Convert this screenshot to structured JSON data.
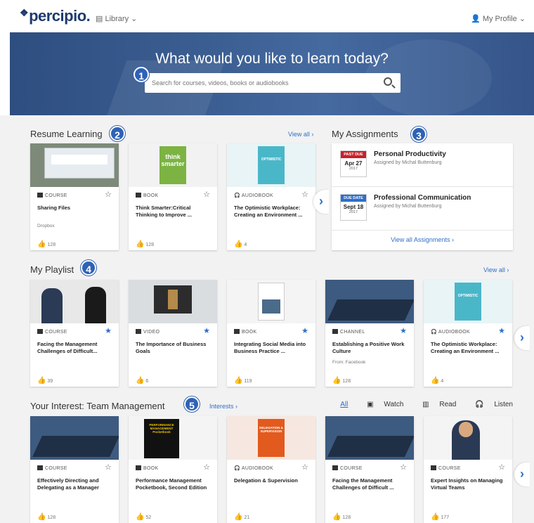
{
  "header": {
    "logo": "percipio.",
    "library": "Library",
    "profile": "My Profile"
  },
  "hero": {
    "title": "What would you like to learn today?",
    "search_placeholder": "Search for courses, videos, books or audiobooks"
  },
  "badges": [
    "1",
    "2",
    "3",
    "4",
    "5"
  ],
  "resume": {
    "title": "Resume Learning",
    "view_all": "View all ›",
    "cards": [
      {
        "type": "COURSE",
        "title": "Sharing Files",
        "sub": "Dropbox",
        "likes": "128",
        "liked": false,
        "starred": false
      },
      {
        "type": "BOOK",
        "title": "Think Smarter:Critical Thinking to Improve ...",
        "sub": "",
        "likes": "128",
        "liked": true,
        "starred": false
      },
      {
        "type": "AUDIOBOOK",
        "title": "The Optimistic Workplace: Creating an Environment ...",
        "sub": "",
        "likes": "4",
        "liked": false,
        "starred": false
      }
    ]
  },
  "assignments": {
    "title": "My Assignments",
    "items": [
      {
        "tag": "PAST DUE",
        "date": "Apr 27",
        "year": "2017",
        "title": "Personal Productivity",
        "by": "Assigned by Michal Buttenburg",
        "color": "#c8202a"
      },
      {
        "tag": "DUE DATE",
        "date": "Sept 18",
        "year": "2017",
        "title": "Professional Communication",
        "by": "Assigned by Michal Buttenburg",
        "color": "#2f6fc9"
      }
    ],
    "view_all": "View all Assignments ›"
  },
  "playlist": {
    "title": "My Playlist",
    "view_all": "View all ›",
    "cards": [
      {
        "type": "COURSE",
        "title": "Facing the Management Challenges of Difficult...",
        "sub": "",
        "likes": "39",
        "liked": false
      },
      {
        "type": "VIDEO",
        "title": "The Importance of Business Goals",
        "sub": "",
        "likes": "6",
        "liked": false
      },
      {
        "type": "BOOK",
        "title": "Integrating Social Media into Business Practice ...",
        "sub": "",
        "likes": "119",
        "liked": false
      },
      {
        "type": "CHANNEL",
        "title": "Establishing a Positive Work Culture",
        "sub": "From: Facebook",
        "likes": "128",
        "liked": true
      },
      {
        "type": "AUDIOBOOK",
        "title": "The Optimistic Workplace: Creating an Environment ...",
        "sub": "",
        "likes": "4",
        "liked": false
      }
    ]
  },
  "interest": {
    "title": "Your Interest: Team Management",
    "interests_link": "Interests ›",
    "filters": [
      "All",
      "Watch",
      "Read",
      "Listen"
    ],
    "cards": [
      {
        "type": "COURSE",
        "title": "Effectively Directing and Delegating as a Manager",
        "likes": "128",
        "liked": true
      },
      {
        "type": "BOOK",
        "title": "Performance Management Pocketbook, Second Edition",
        "likes": "52",
        "liked": false
      },
      {
        "type": "AUDIOBOOK",
        "title": "Delegation & Supervision",
        "likes": "21",
        "liked": false
      },
      {
        "type": "COURSE",
        "title": "Facing the Management Challenges of Difficult ...",
        "likes": "128",
        "liked": true
      },
      {
        "type": "COURSE",
        "title": "Expert Insights on Managing Virtual Teams",
        "likes": "177",
        "liked": false
      }
    ]
  },
  "thumb_art": {
    "think_book": "think smarter",
    "optimistic_book": "OPTIMISTIC",
    "pm_book_1": "PERFORMANCE MANAGEMENT",
    "pm_book_2": "Pocketbook",
    "delegation_book": "DELEGATION & SUPERVISION"
  }
}
